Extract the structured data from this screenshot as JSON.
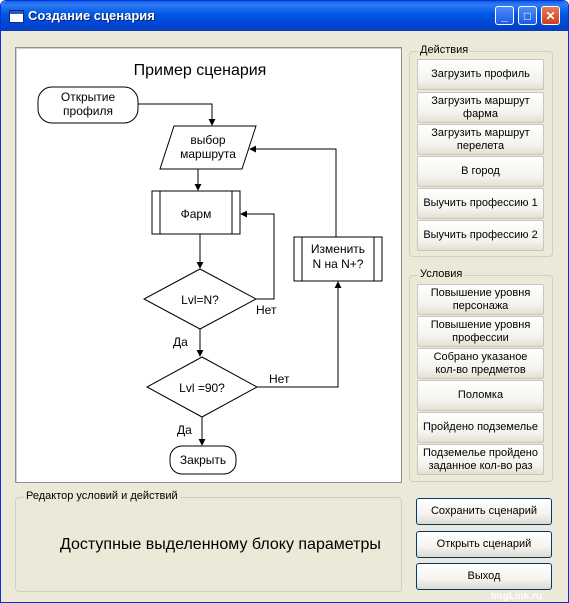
{
  "window": {
    "title": "Создание сценария",
    "min": "_",
    "max": "□",
    "close": "✕"
  },
  "flowchart": {
    "title": "Пример сценария",
    "nodes": {
      "open_profile": "Открытие профиля",
      "route_select": "выбор маршрута",
      "farm": "Фарм",
      "lvl_n": "Lvl=N?",
      "lvl_90": "Lvl =90?",
      "change_n": "Изменить N на N+?",
      "close": "Закрыть"
    },
    "labels": {
      "no1": "Нет",
      "yes1": "Да",
      "no2": "Нет",
      "yes2": "Да"
    }
  },
  "actions": {
    "title": "Действия",
    "buttons": [
      "Загрузить профиль",
      "Загрузить маршрут фарма",
      "Загрузить маршрут перелета",
      "В город",
      "Выучить профессию 1",
      "Выучить профессию 2"
    ]
  },
  "conditions": {
    "title": "Условия",
    "buttons": [
      "Повышение уровня персонажа",
      "Повышение уровня профессии",
      "Собрано указаное кол-во предметов",
      "Поломка",
      "Пройдено подземелье",
      "Подземелье пройдено заданное кол-во раз"
    ]
  },
  "editor": {
    "title": "Редактор условий и действий",
    "text": "Доступные выделенному блоку параметры"
  },
  "bottom_buttons": {
    "save": "Сохранить сценарий",
    "open": "Открыть сценарий",
    "exit": "Выход"
  },
  "watermark": "ImgLink.ru"
}
